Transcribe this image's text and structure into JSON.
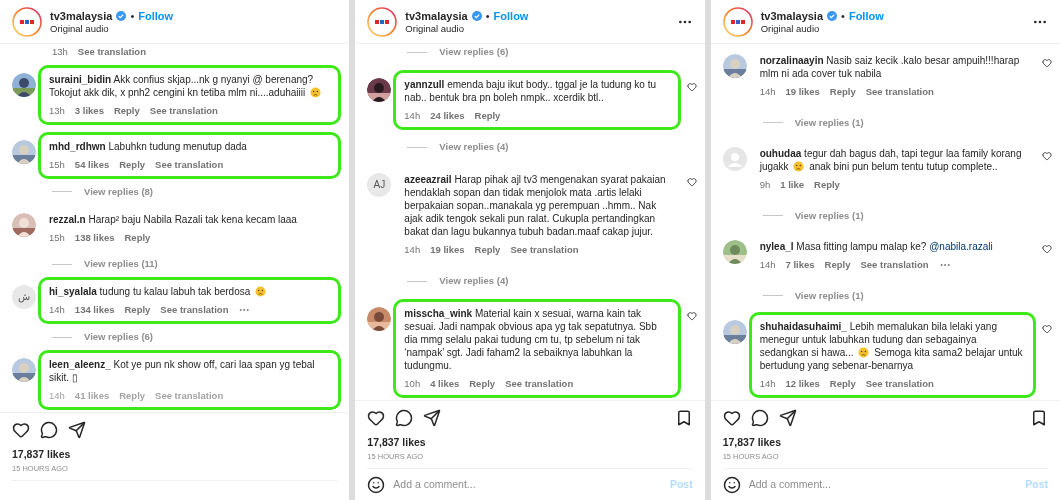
{
  "panels": [
    {
      "header": {
        "username": "tv3malaysia",
        "separator": "•",
        "follow": "Follow",
        "audio": "Original audio",
        "more": false
      },
      "comment_hearts": false,
      "items": [
        {
          "kind": "meta",
          "time": "13h",
          "translate": "See translation"
        },
        {
          "kind": "comment",
          "highlighted": true,
          "faded": false,
          "more": false,
          "avatar": {
            "kind": "picture"
          },
          "user": "suraini_bidin",
          "body": [
            {
              "kind": "text",
              "text": "Akk confius skjap...nk g nyanyi @ berenang? Tokojut akk dik, x pnh2 cengini kn tetiba mlm ni....aduhaiiii"
            },
            {
              "kind": "emoji"
            }
          ],
          "time": "13h",
          "likes": "3 likes",
          "reply": "Reply",
          "translate": "See translation"
        },
        {
          "kind": "comment",
          "highlighted": true,
          "faded": false,
          "more": false,
          "avatar": {
            "kind": "picture"
          },
          "user": "mhd_rdhwn",
          "body": [
            {
              "kind": "text",
              "text": "Labuhkn tudung menutup dada"
            }
          ],
          "time": "15h",
          "likes": "54 likes",
          "reply": "Reply",
          "translate": "See translation"
        },
        {
          "kind": "replies",
          "label": "View replies (8)"
        },
        {
          "kind": "comment",
          "highlighted": false,
          "faded": false,
          "more": false,
          "avatar": {
            "kind": "picture"
          },
          "user": "rezzal.n",
          "body": [
            {
              "kind": "text",
              "text": "Harap² baju Nabila Razali tak kena kecam laaa"
            }
          ],
          "time": "15h",
          "likes": "138 likes",
          "reply": "Reply"
        },
        {
          "kind": "replies",
          "label": "View replies (11)"
        },
        {
          "kind": "comment",
          "highlighted": true,
          "faded": false,
          "more": true,
          "avatar": {
            "kind": "letters",
            "text": "ش"
          },
          "user": "hi_syalala",
          "body": [
            {
              "kind": "text",
              "text": "tudung tu kalau labuh tak berdosa"
            },
            {
              "kind": "emoji"
            }
          ],
          "time": "14h",
          "likes": "134 likes",
          "reply": "Reply",
          "translate": "See translation"
        },
        {
          "kind": "replies",
          "label": "View replies (6)"
        },
        {
          "kind": "comment",
          "highlighted": true,
          "faded": true,
          "more": false,
          "avatar": {
            "kind": "picture"
          },
          "user": "leen_aleenz_",
          "body": [
            {
              "kind": "text",
              "text": "Kot ye pun nk show off, cari laa span yg tebal sikit. ▯"
            }
          ],
          "time": "14h",
          "likes": "41 likes",
          "reply": "Reply",
          "translate": "See translation"
        }
      ],
      "footer": {
        "bookmark": false,
        "likes": "17,837 likes",
        "time": "15 HOURS AGO"
      }
    },
    {
      "header": {
        "username": "tv3malaysia",
        "separator": "•",
        "follow": "Follow",
        "audio": "Original audio",
        "more": true
      },
      "comment_hearts": true,
      "items": [
        {
          "kind": "replies",
          "label": "View replies (6)"
        },
        {
          "kind": "comment",
          "highlighted": true,
          "faded": false,
          "more": false,
          "avatar": {
            "kind": "picture"
          },
          "user": "yannzull",
          "body": [
            {
              "kind": "text",
              "text": "emenda baju ikut body.. tggal je la tudung ko tu nab.. bentuk bra pn boleh nmpk.. xcerdik btl.."
            }
          ],
          "time": "14h",
          "likes": "24 likes",
          "reply": "Reply"
        },
        {
          "kind": "replies",
          "label": "View replies (4)"
        },
        {
          "kind": "comment",
          "highlighted": false,
          "faded": false,
          "more": false,
          "avatar": {
            "kind": "letters",
            "text": "AJ"
          },
          "user": "azeeazrail",
          "body": [
            {
              "kind": "text",
              "text": "Harap pihak ajl tv3 mengenakan syarat pakaian hendaklah sopan dan tidak menjolok mata .artis lelaki berpakaian sopan..manakala yg perempuan ..hmm.. Nak ajak adik tengok sekali pun ralat. Cukupla pertandingkan bakat dan lagu bukannya tubuh badan.maaf cakap jujur."
            }
          ],
          "time": "14h",
          "likes": "19 likes",
          "reply": "Reply",
          "translate": "See translation"
        },
        {
          "kind": "replies",
          "label": "View replies (4)"
        },
        {
          "kind": "comment",
          "highlighted": true,
          "faded": false,
          "more": false,
          "avatar": {
            "kind": "picture"
          },
          "user": "misscha_wink",
          "body": [
            {
              "kind": "text",
              "text": "Material kain x sesuai, warna kain tak sesuai. Jadi nampak obvious apa yg tak sepatutnya. Sbb dia mmg selalu pakai tudung cm tu, tp sebelum ni tak ‘nampak’ sgt. Jadi faham2 la sebaiknya labuhkan la tudungmu."
            }
          ],
          "time": "10h",
          "likes": "4 likes",
          "reply": "Reply",
          "translate": "See translation"
        }
      ],
      "footer": {
        "bookmark": true,
        "likes": "17,837 likes",
        "time": "15 HOURS AGO",
        "add_comment": {
          "placeholder": "Add a comment...",
          "post": "Post"
        }
      }
    },
    {
      "header": {
        "username": "tv3malaysia",
        "separator": "•",
        "follow": "Follow",
        "audio": "Original audio",
        "more": true
      },
      "comment_hearts": true,
      "items": [
        {
          "kind": "comment",
          "highlighted": false,
          "faded": false,
          "more": false,
          "avatar": {
            "kind": "picture"
          },
          "user": "norzalinaayin",
          "body": [
            {
              "kind": "text",
              "text": "Nasib saiz kecik .kalo besar ampuih!!!harap mlm ni ada cover tuk nabila"
            }
          ],
          "time": "14h",
          "likes": "19 likes",
          "reply": "Reply",
          "translate": "See translation"
        },
        {
          "kind": "replies",
          "label": "View replies (1)"
        },
        {
          "kind": "comment",
          "highlighted": false,
          "faded": false,
          "more": false,
          "avatar": {
            "kind": "blank"
          },
          "user": "ouhudaa",
          "body": [
            {
              "kind": "text",
              "text": "tegur dah bagus dah, tapi tegur laa family korang jugakk"
            },
            {
              "kind": "emoji"
            },
            {
              "kind": "text",
              "text": "anak bini pun belum tentu tutup complete.."
            }
          ],
          "time": "9h",
          "likes": "1 like",
          "reply": "Reply"
        },
        {
          "kind": "replies",
          "label": "View replies (1)"
        },
        {
          "kind": "comment",
          "highlighted": false,
          "faded": false,
          "more": true,
          "avatar": {
            "kind": "picture"
          },
          "user": "nylea_l",
          "body": [
            {
              "kind": "text",
              "text": "Masa fitting lampu malap ke?"
            },
            {
              "kind": "mention",
              "text": "@nabila.razali"
            }
          ],
          "time": "14h",
          "likes": "7 likes",
          "reply": "Reply",
          "translate": "See translation"
        },
        {
          "kind": "replies",
          "label": "View replies (1)"
        },
        {
          "kind": "comment",
          "highlighted": true,
          "faded": false,
          "more": false,
          "avatar": {
            "kind": "picture"
          },
          "user": "shuhaidasuhaimi_",
          "body": [
            {
              "kind": "text",
              "text": "Lebih memalukan bila lelaki yang menegur untuk labuhkan tudung dan sebagainya sedangkan si hawa..."
            },
            {
              "kind": "emoji"
            },
            {
              "kind": "text",
              "text": "Semoga kita sama2 belajar untuk bertudung yang sebenar-benarnya"
            }
          ],
          "time": "14h",
          "likes": "12 likes",
          "reply": "Reply",
          "translate": "See translation"
        }
      ],
      "footer": {
        "bookmark": true,
        "likes": "17,837 likes",
        "time": "15 HOURS AGO",
        "add_comment": {
          "placeholder": "Add a comment...",
          "post": "Post"
        }
      }
    }
  ]
}
